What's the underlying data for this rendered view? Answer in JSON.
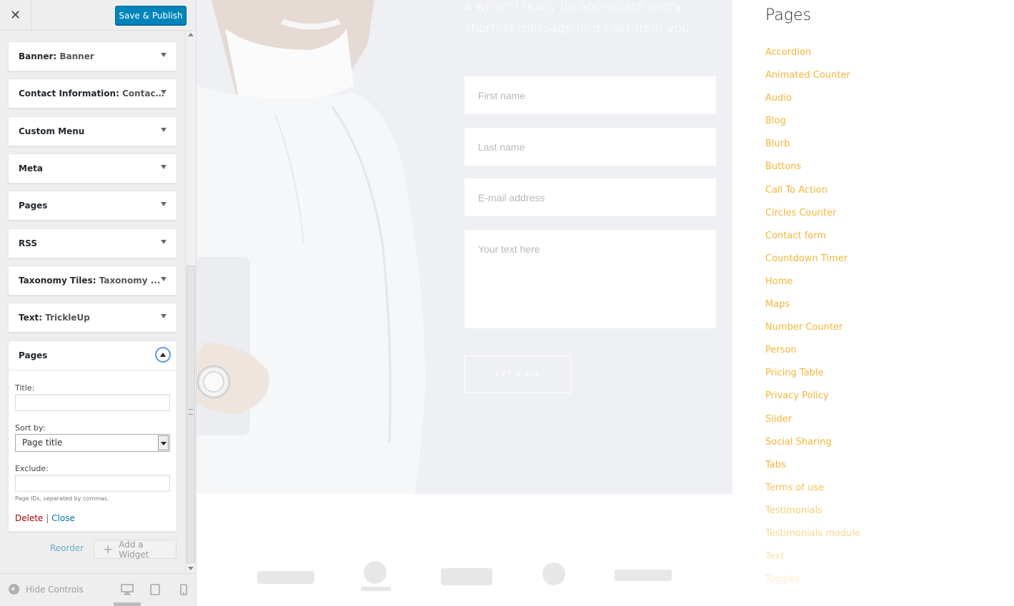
{
  "sidebar": {
    "close_glyph": "✕",
    "publish_label": "Save & Publish",
    "widgets": [
      {
        "name": "Banner",
        "sub": "Banner"
      },
      {
        "name": "Contact Information",
        "sub": "Contact..."
      },
      {
        "name": "Custom Menu",
        "sub": ""
      },
      {
        "name": "Meta",
        "sub": ""
      },
      {
        "name": "Pages",
        "sub": ""
      },
      {
        "name": "RSS",
        "sub": ""
      },
      {
        "name": "Taxonomy Tiles",
        "sub": "Taxonomy ..."
      },
      {
        "name": "Text",
        "sub": "TrickleUp"
      }
    ],
    "open_widget": {
      "name": "Pages",
      "title_label": "Title:",
      "title_value": "",
      "sort_label": "Sort by:",
      "sort_value": "Page title",
      "exclude_label": "Exclude:",
      "exclude_value": "",
      "exclude_help": "Page IDs, separated by commas.",
      "delete_label": "Delete",
      "separator": "|",
      "close_label": "Close"
    },
    "reorder_label": "Reorder",
    "add_widget_label": "Add a Widget",
    "hide_controls_label": "Hide Controls"
  },
  "preview": {
    "intro_text": "a writer I really do appreciate every shortest message or q I get from you.",
    "form": {
      "first_name_placeholder": "First name",
      "last_name_placeholder": "Last name",
      "email_placeholder": "E-mail address",
      "message_placeholder": "Your text here",
      "submit_label": "LET'S GO"
    },
    "pages_widget": {
      "title": "Pages",
      "items": [
        "Accordion",
        "Animated Counter",
        "Audio",
        "Blog",
        "Blurb",
        "Buttons",
        "Call To Action",
        "Circles Counter",
        "Contact form",
        "Countdown Timer",
        "Home",
        "Maps",
        "Number Counter",
        "Person",
        "Pricing Table",
        "Privacy Policy",
        "Slider",
        "Social Sharing",
        "Tabs",
        "Terms of use",
        "Testimonials",
        "Testimonials module",
        "Text",
        "Toggles"
      ],
      "item_color": "#f5b537"
    }
  },
  "colors": {
    "publish_button": "#0085ba",
    "link_blue": "#0073aa",
    "delete_red": "#aa0000",
    "accent_orange": "#f5b537"
  }
}
